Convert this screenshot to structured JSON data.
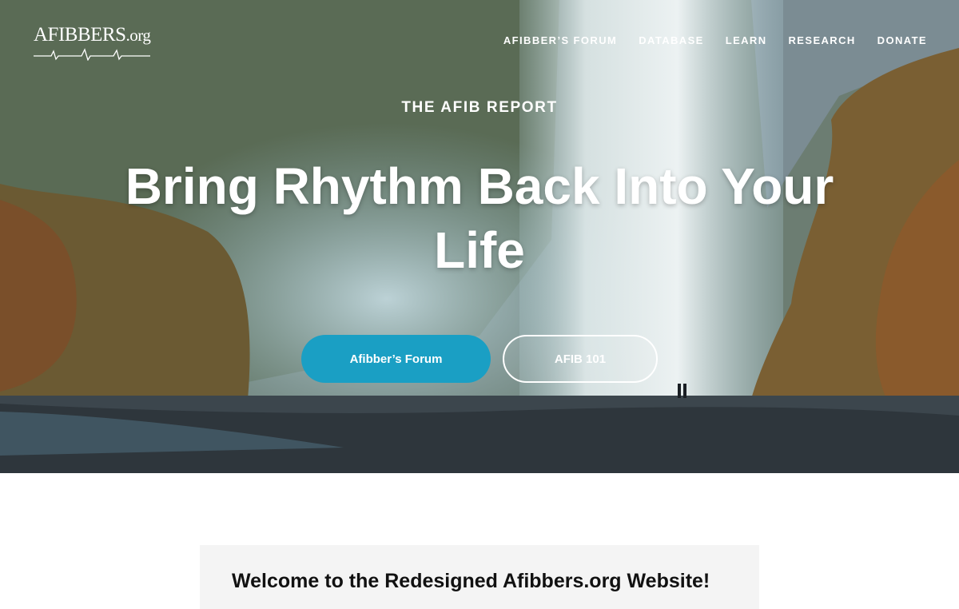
{
  "brand": {
    "logo_text": "AFIBBERS",
    "logo_suffix": ".org"
  },
  "nav": {
    "items": [
      {
        "label": "AFIBBER’S FORUM"
      },
      {
        "label": "DATABASE"
      },
      {
        "label": "LEARN"
      },
      {
        "label": "RESEARCH"
      },
      {
        "label": "DONATE"
      }
    ]
  },
  "hero": {
    "kicker": "THE AFIB REPORT",
    "headline": "Bring Rhythm Back Into Your Life",
    "primary_button": "Afibber’s Forum",
    "secondary_button": "AFIB 101"
  },
  "content": {
    "welcome_title": "Welcome to the Redesigned Afibbers.org Website!"
  },
  "colors": {
    "accent": "#1a9fc4",
    "text_on_hero": "#ffffff"
  }
}
